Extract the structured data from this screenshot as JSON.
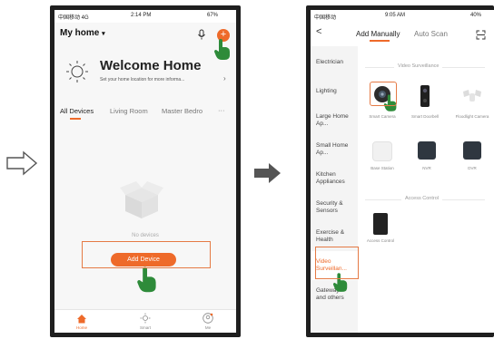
{
  "left_phone": {
    "status": {
      "carrier": "中国移动 4G",
      "time": "2:14 PM",
      "battery": "67%"
    },
    "home_title": "My home",
    "welcome_title": "Welcome Home",
    "welcome_sub": "Set your home location for more informa...",
    "tabs": [
      "All Devices",
      "Living Room",
      "Master Bedro"
    ],
    "more": "···",
    "empty_text": "No devices",
    "add_device": "Add Device",
    "tabbar": [
      "Home",
      "Smart",
      "Me"
    ]
  },
  "right_phone": {
    "status": {
      "carrier": "中国移动",
      "time": "9:05 AM",
      "battery": "40%"
    },
    "back": "<",
    "tab_manual": "Add Manually",
    "tab_auto": "Auto Scan",
    "categories": [
      "Electrician",
      "Lighting",
      "Large Home Ap...",
      "Small Home Ap...",
      "Kitchen Appliances",
      "Security & Sensors",
      "Exercise & Health",
      "Video Surveillan...",
      "Gateway and others"
    ],
    "section_video": "Video Surveillance",
    "devices_row1": [
      "Smart Camera",
      "Smart Doorbell",
      "Floodlight Camera"
    ],
    "devices_row2": [
      "Base Station",
      "NVR",
      "DVR"
    ],
    "section_access": "Access Control",
    "devices_row3": [
      "Access Control"
    ]
  },
  "colors": {
    "accent": "#ee6a2a",
    "highlight": "#e57a45",
    "hand": "#2e8b3a"
  }
}
